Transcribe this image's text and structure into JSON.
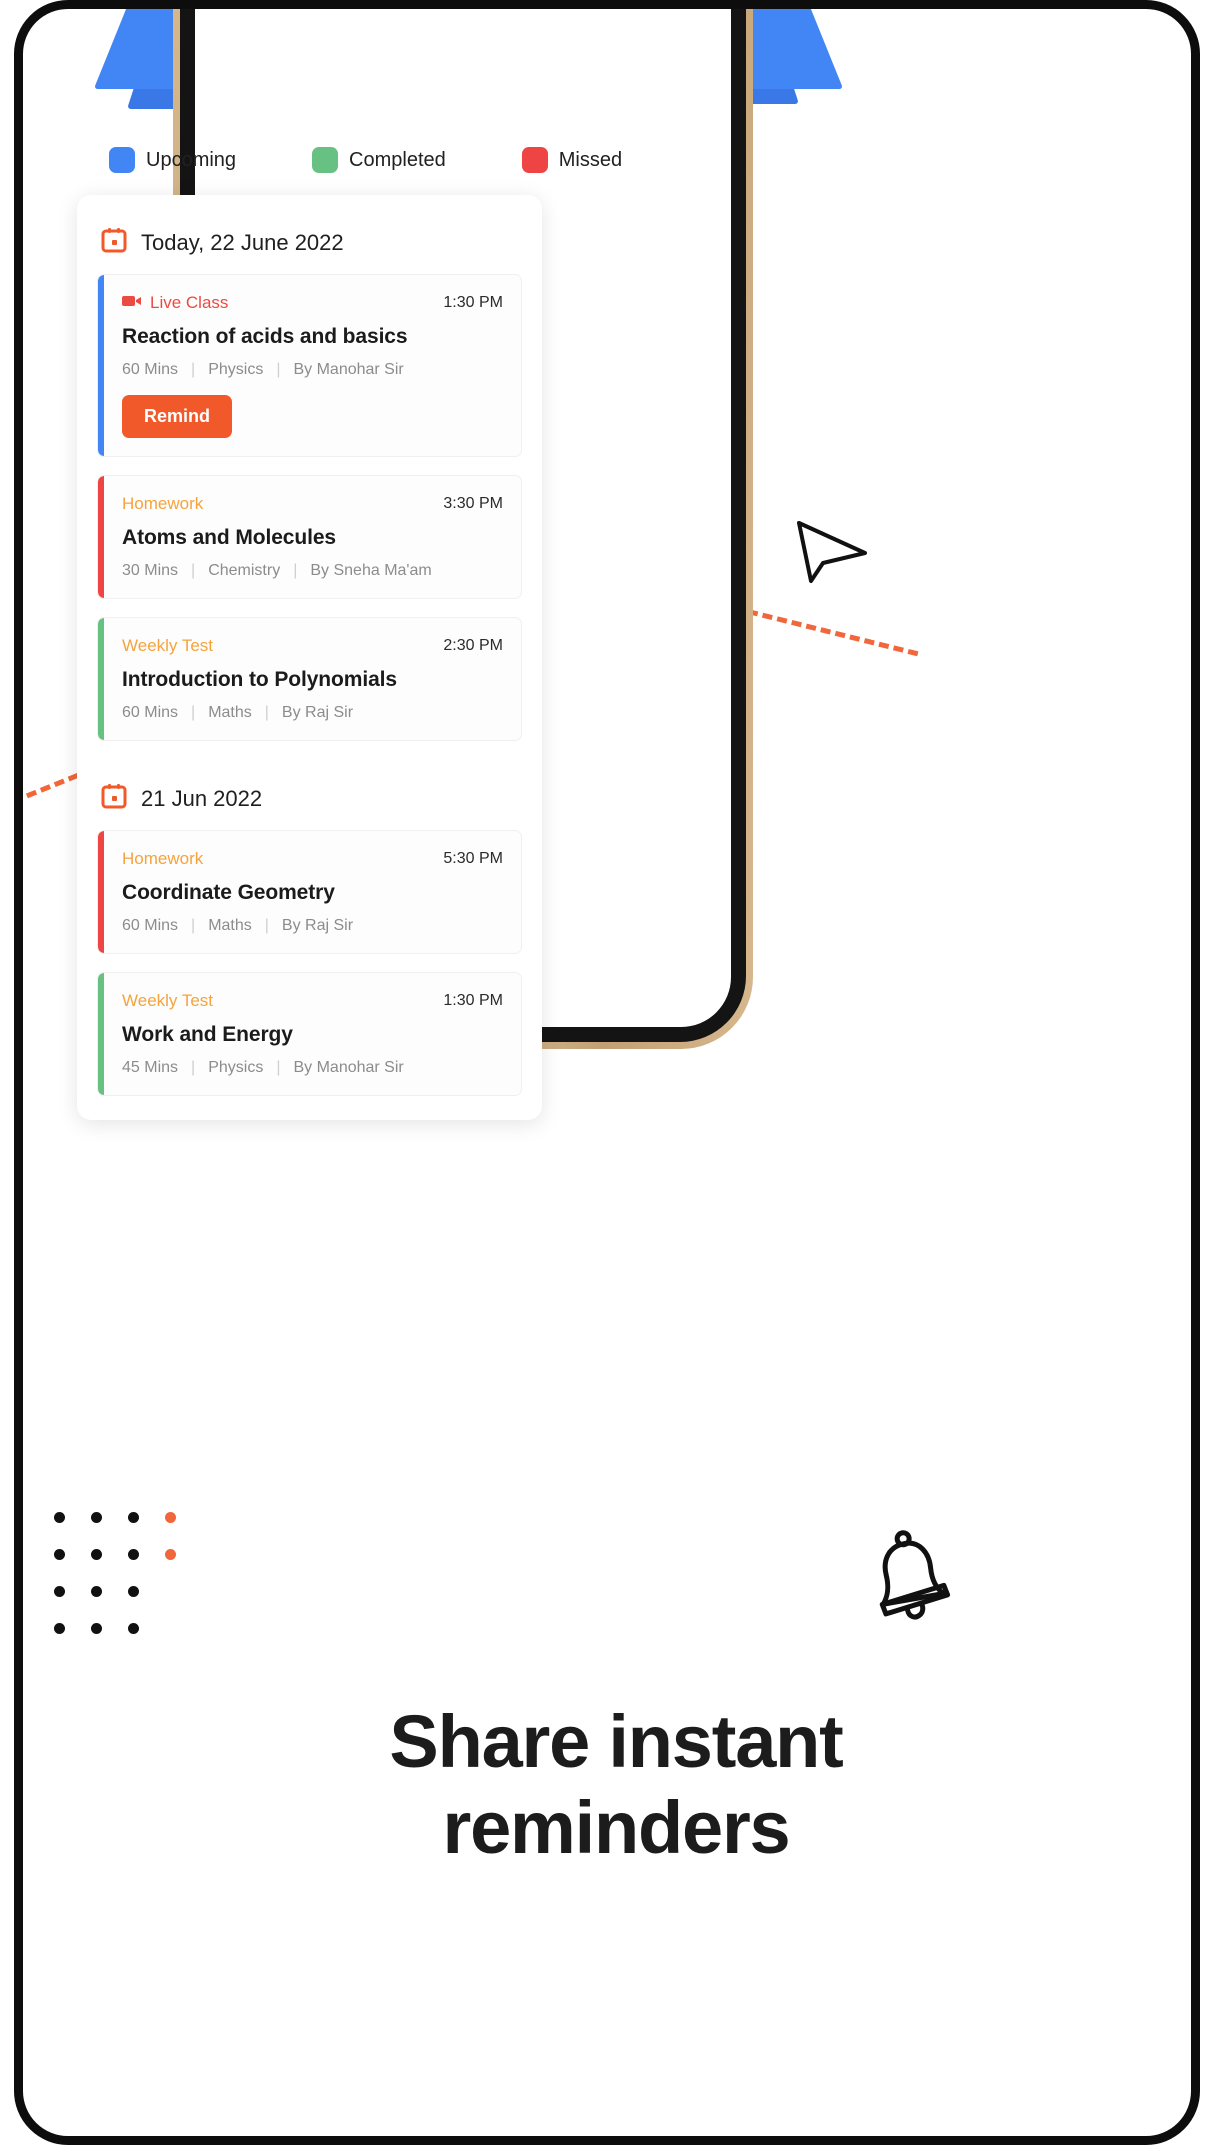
{
  "legend": {
    "items": [
      {
        "label": "Upcoming",
        "color": "#4285F4"
      },
      {
        "label": "Completed",
        "color": "#66C183"
      },
      {
        "label": "Missed",
        "color": "#EF4444"
      }
    ]
  },
  "schedule": {
    "groups": [
      {
        "date_label": "Today, 22 June 2022",
        "calendar_icon": "calendar-icon",
        "events": [
          {
            "type": "Live Class",
            "type_color": "#EA4C43",
            "type_icon": "video-camera-icon",
            "accent_color": "#4285F4",
            "status": "Upcoming",
            "time": "1:30 PM",
            "title": "Reaction of acids and basics",
            "duration": "60 Mins",
            "subject": "Physics",
            "teacher": "By Manohar Sir",
            "action_label": "Remind",
            "action_color": "#F1592A"
          },
          {
            "type": "Homework",
            "type_color": "#F5A33C",
            "type_icon": "",
            "accent_color": "#EF4444",
            "status": "Missed",
            "time": "3:30 PM",
            "title": "Atoms and Molecules",
            "duration": "30 Mins",
            "subject": "Chemistry",
            "teacher": "By Sneha Ma'am",
            "action_label": "",
            "action_color": ""
          },
          {
            "type": "Weekly Test",
            "type_color": "#F5A33C",
            "type_icon": "",
            "accent_color": "#66C183",
            "status": "Completed",
            "time": "2:30 PM",
            "title": "Introduction to Polynomials",
            "duration": "60 Mins",
            "subject": "Maths",
            "teacher": "By Raj Sir",
            "action_label": "",
            "action_color": ""
          }
        ]
      },
      {
        "date_label": "21 Jun 2022",
        "calendar_icon": "calendar-icon",
        "events": [
          {
            "type": "Homework",
            "type_color": "#F5A33C",
            "type_icon": "",
            "accent_color": "#EF4444",
            "status": "Missed",
            "time": "5:30 PM",
            "title": "Coordinate Geometry",
            "duration": "60 Mins",
            "subject": "Maths",
            "teacher": "By Raj Sir",
            "action_label": "",
            "action_color": ""
          },
          {
            "type": "Weekly Test",
            "type_color": "#F5A33C",
            "type_icon": "",
            "accent_color": "#66C183",
            "status": "Completed",
            "time": "1:30 PM",
            "title": "Work and Energy",
            "duration": "45 Mins",
            "subject": "Physics",
            "teacher": "By Manohar Sir",
            "action_label": "",
            "action_color": ""
          }
        ]
      }
    ]
  },
  "headline": {
    "line1": "Share instant",
    "line2": "reminders"
  },
  "decor": {
    "bell_icon": "bell-icon",
    "arrow_icon": "arrow-cursor-icon",
    "dot_accent_color": "#F1663A",
    "dot_color": "#111111",
    "ribbon_color": "#4285F4",
    "dash_color": "#F1663A"
  },
  "separator": "|"
}
